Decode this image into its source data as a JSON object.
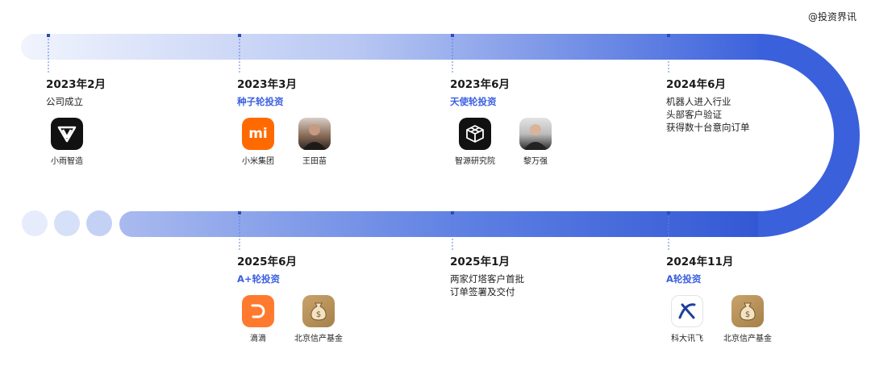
{
  "watermark": "@投资界讯",
  "colors": {
    "track_start": "#eef2fd",
    "track_end": "#3358d6",
    "accent": "#3b5fe0",
    "dot": "#2a4db8"
  },
  "milestones": [
    {
      "date": "2023年2月",
      "desc": [
        "公司成立"
      ],
      "desc_highlight": false,
      "logos": [
        {
          "name": "小雨智造",
          "icon": "xiaoyu-logo-icon"
        }
      ]
    },
    {
      "date": "2023年3月",
      "desc": [
        "种子轮投资"
      ],
      "desc_highlight": true,
      "logos": [
        {
          "name": "小米集团",
          "icon": "xiaomi-logo-icon",
          "mark": "mi"
        },
        {
          "name": "王田苗",
          "icon": "person-photo-icon"
        }
      ]
    },
    {
      "date": "2023年6月",
      "desc": [
        "天使轮投资"
      ],
      "desc_highlight": true,
      "logos": [
        {
          "name": "智源研究院",
          "icon": "baai-logo-icon"
        },
        {
          "name": "黎万强",
          "icon": "person-photo-icon"
        }
      ]
    },
    {
      "date": "2024年6月",
      "desc": [
        "机器人进入行业",
        "头部客户验证",
        "获得数十台意向订单"
      ],
      "desc_highlight": false,
      "logos": []
    },
    {
      "date": "2025年6月",
      "desc": [
        "A+轮投资"
      ],
      "desc_highlight": true,
      "logos": [
        {
          "name": "滴滴",
          "icon": "didi-logo-icon"
        },
        {
          "name": "北京信产基金",
          "icon": "money-bag-icon",
          "mark": "$"
        }
      ]
    },
    {
      "date": "2025年1月",
      "desc": [
        "两家灯塔客户首批",
        "订单签署及交付"
      ],
      "desc_highlight": false,
      "logos": []
    },
    {
      "date": "2024年11月",
      "desc": [
        "A轮投资"
      ],
      "desc_highlight": true,
      "logos": [
        {
          "name": "科大讯飞",
          "icon": "iflytek-logo-icon"
        },
        {
          "name": "北京信产基金",
          "icon": "money-bag-icon",
          "mark": "$"
        }
      ]
    }
  ]
}
